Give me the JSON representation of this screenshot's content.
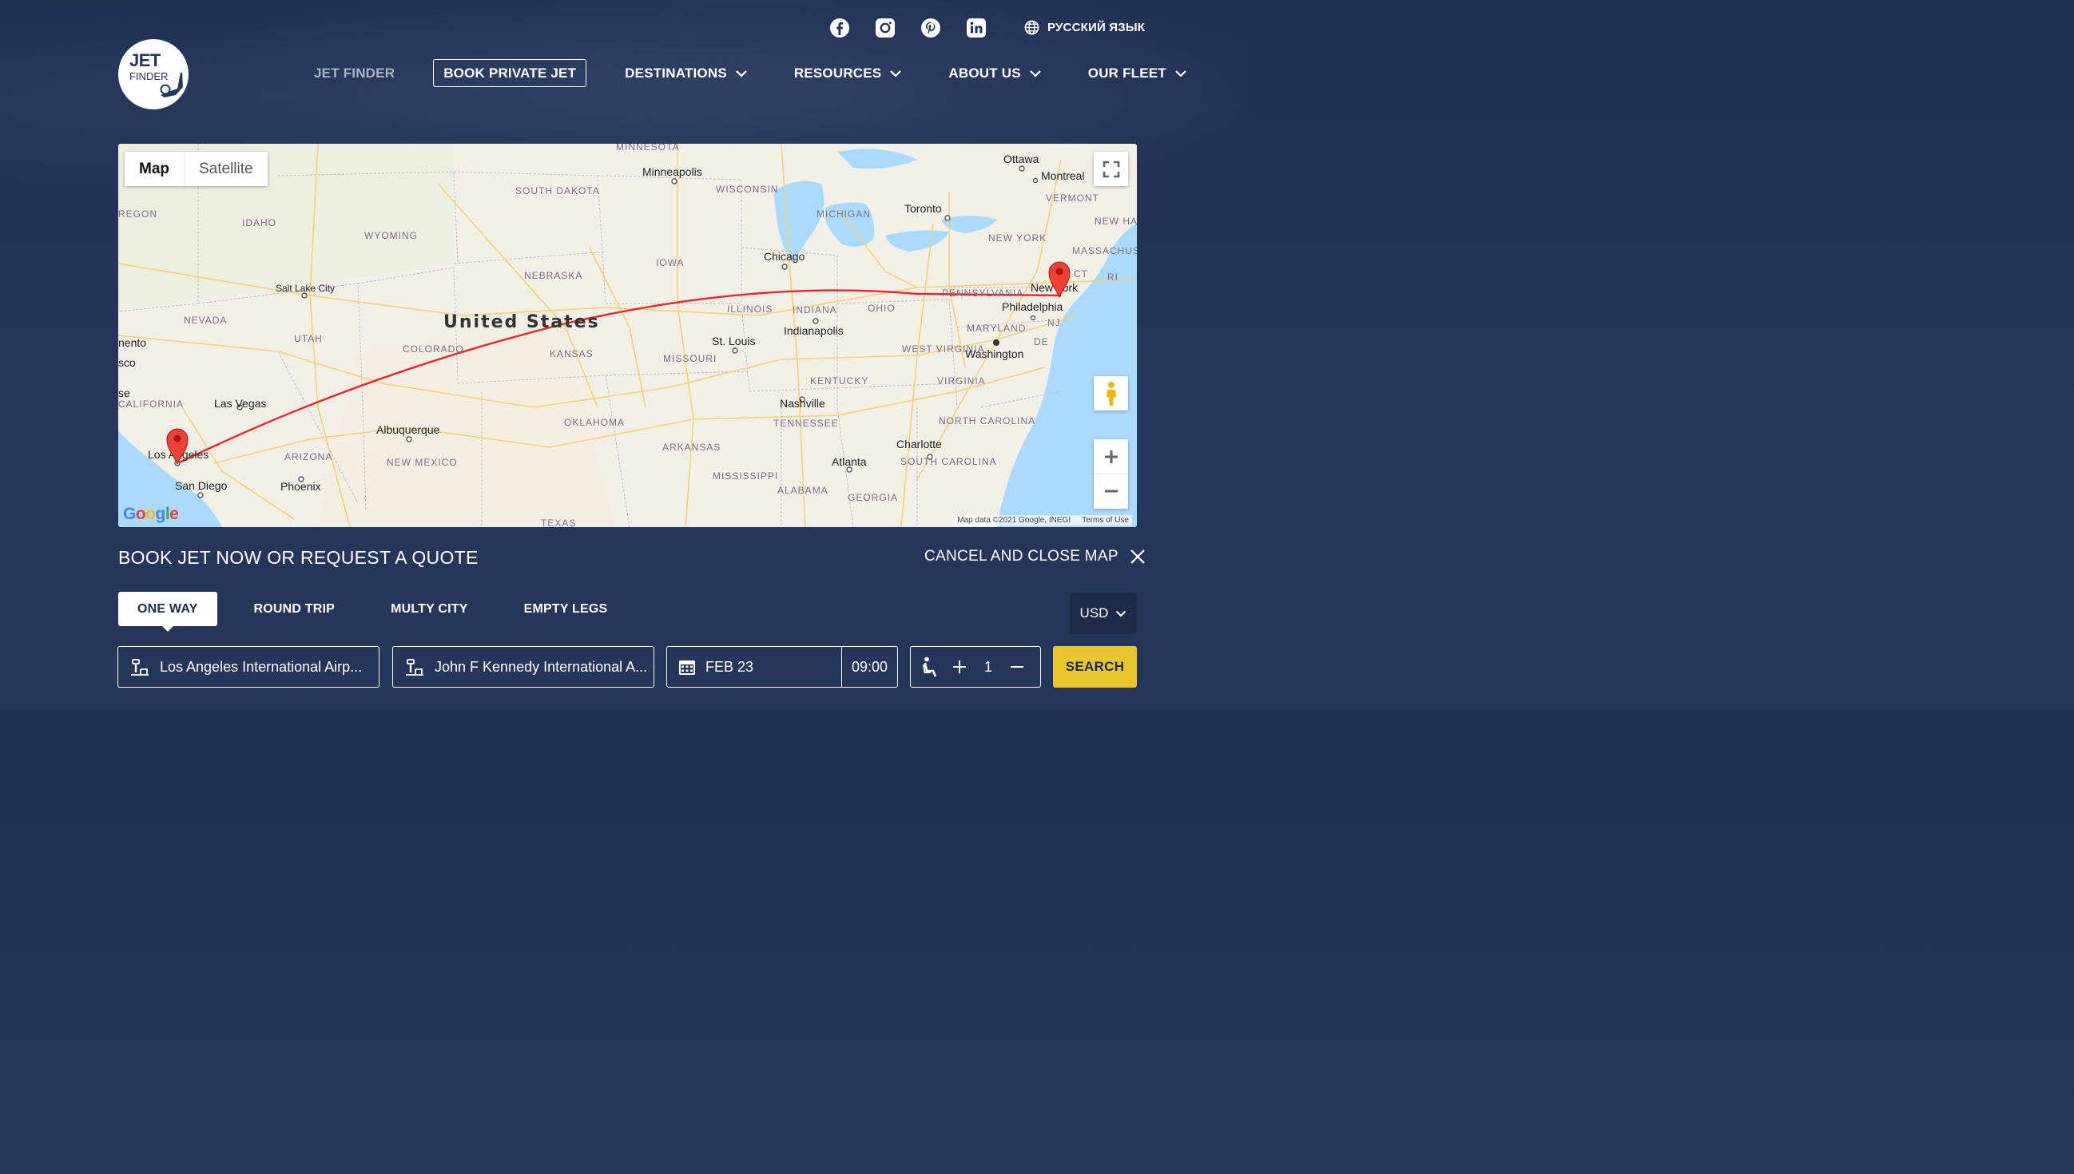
{
  "header": {
    "logo_top": "JET",
    "logo_bottom": "FINDER",
    "social": [
      "facebook-icon",
      "instagram-icon",
      "pinterest-icon",
      "linkedin-icon"
    ],
    "language": "РУССКИЙ ЯЗЫК"
  },
  "nav": [
    {
      "label": "JET FINDER",
      "dropdown": false
    },
    {
      "label": "BOOK PRIVATE JET",
      "dropdown": false
    },
    {
      "label": "DESTINATIONS",
      "dropdown": true
    },
    {
      "label": "RESOURCES",
      "dropdown": true
    },
    {
      "label": "ABOUT US",
      "dropdown": true
    },
    {
      "label": "OUR FLEET",
      "dropdown": true
    }
  ],
  "map": {
    "type_options": [
      "Map",
      "Satellite"
    ],
    "selected_type": "Map",
    "country_label": "United States",
    "route_color": "#e8262c",
    "attribution": "Map data ©2021 Google, INEGI",
    "terms": "Terms of Use",
    "google_logo": "Google",
    "states": [
      "MINNESOTA",
      "SOUTH DAKOTA",
      "WISCONSIN",
      "MICHIGAN",
      "IDAHO",
      "WYOMING",
      "IOWA",
      "NEBRASKA",
      "NEVADA",
      "UTAH",
      "COLORADO",
      "KANSAS",
      "MISSOURI",
      "ILLINOIS",
      "INDIANA",
      "OHIO",
      "PENNSYLVANIA",
      "NEW YORK",
      "VERMONT",
      "NEW HAMPSHIRE",
      "MASSACHUSETTS",
      "MARYLAND",
      "WEST VIRGINIA",
      "VIRGINIA",
      "KENTUCKY",
      "TENNESSEE",
      "NORTH CAROLINA",
      "SOUTH CAROLINA",
      "OKLAHOMA",
      "ARKANSAS",
      "MISSISSIPPI",
      "ALABAMA",
      "GEORGIA",
      "TEXAS",
      "ARIZONA",
      "NEW MEXICO",
      "CALIFORNIA",
      "REGON",
      "CT",
      "RI",
      "NJ",
      "DE"
    ],
    "cities": [
      "Minneapolis",
      "Ottawa",
      "Montreal",
      "Toronto",
      "Chicago",
      "Salt Lake City",
      "Indianapolis",
      "St. Louis",
      "New York",
      "Philadelphia",
      "Washington",
      "Nashville",
      "Charlotte",
      "Atlanta",
      "Las Vegas",
      "Albuquerque",
      "Los Angeles",
      "San Diego",
      "Phoenix",
      "nento",
      "sco",
      "se"
    ]
  },
  "booking": {
    "title": "BOOK JET NOW OR REQUEST A QUOTE",
    "cancel_label": "CANCEL AND CLOSE MAP",
    "tabs": [
      "ONE WAY",
      "ROUND TRIP",
      "MULTY CITY",
      "EMPTY LEGS"
    ],
    "active_tab": "ONE WAY",
    "currency": "USD",
    "from": "Los Angeles International Airp...",
    "to": "John F Kennedy International A...",
    "date": "FEB 23",
    "time": "09:00",
    "passengers": "1",
    "search_label": "SEARCH"
  }
}
